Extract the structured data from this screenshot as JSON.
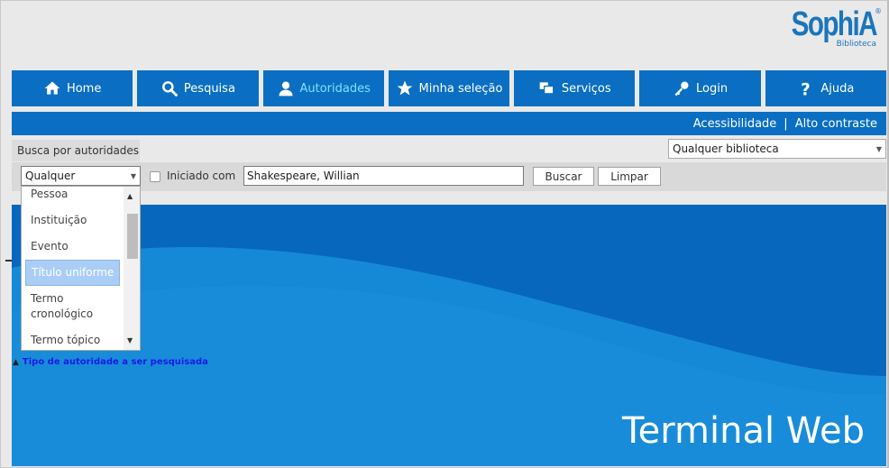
{
  "logo": {
    "word": "SophiA",
    "subtitle": "Biblioteca",
    "reg": "®"
  },
  "nav": [
    {
      "label": "Home",
      "icon": "home-icon"
    },
    {
      "label": "Pesquisa",
      "icon": "search-icon"
    },
    {
      "label": "Autoridades",
      "icon": "user-icon",
      "active": true
    },
    {
      "label": "Minha seleção",
      "icon": "star-icon"
    },
    {
      "label": "Serviços",
      "icon": "windows-icon"
    },
    {
      "label": "Login",
      "icon": "key-icon"
    },
    {
      "label": "Ajuda",
      "icon": "question-icon"
    }
  ],
  "accessibility": {
    "acessibilidade": "Acessibilidade",
    "separator": "|",
    "alto_contraste": "Alto contraste"
  },
  "tab": {
    "label": "Busca por autoridades"
  },
  "library_select": {
    "value": "Qualquer biblioteca"
  },
  "search": {
    "type_value": "Qualquer",
    "starts_with_label": "Iniciado com",
    "term_value": "Shakespeare, Willian",
    "buscar_label": "Buscar",
    "limpar_label": "Limpar"
  },
  "dropdown": {
    "items": [
      "Pessoa",
      "Instituição",
      "Evento",
      "Título uniforme",
      "Termo cronológico",
      "Termo tópico"
    ],
    "selected": "Título uniforme"
  },
  "hint": {
    "text": "Tipo de autoridade a ser pesquisada"
  },
  "banner": {
    "title": "Terminal Web"
  },
  "colors": {
    "primary": "#0a6fc2",
    "active_text": "#7fe0ff",
    "banner_dark": "#0767bd",
    "banner_light": "#1589d6"
  }
}
